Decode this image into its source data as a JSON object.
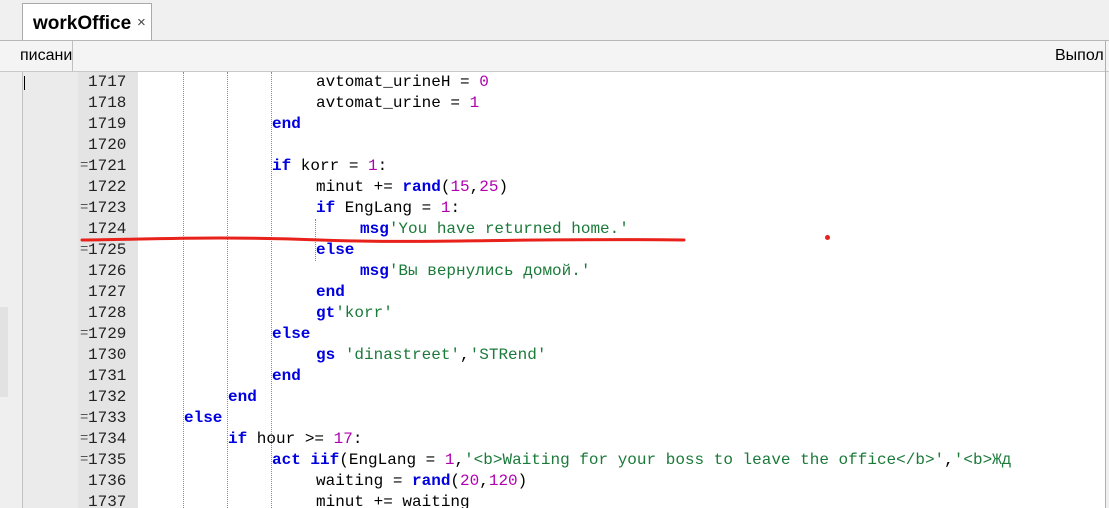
{
  "tab": {
    "title": "workOffice",
    "close_glyph": "×"
  },
  "subheader": {
    "left_label": "писани",
    "right_label": "Выпол"
  },
  "lines": [
    {
      "num": "1717",
      "fold": "",
      "parts": [
        {
          "t": "avtomat_urineH = ",
          "c": "op"
        },
        {
          "t": "0",
          "c": "num"
        }
      ]
    },
    {
      "num": "1718",
      "fold": "",
      "parts": [
        {
          "t": "avtomat_urine = ",
          "c": "op"
        },
        {
          "t": "1",
          "c": "num"
        }
      ]
    },
    {
      "num": "1719",
      "fold": "",
      "parts": [
        {
          "t": "end",
          "c": "kw"
        }
      ]
    },
    {
      "num": "1720",
      "fold": "",
      "parts": []
    },
    {
      "num": "1721",
      "fold": "=",
      "parts": [
        {
          "t": "if",
          "c": "kw"
        },
        {
          "t": " korr = ",
          "c": "op"
        },
        {
          "t": "1",
          "c": "num"
        },
        {
          "t": ":",
          "c": "op"
        }
      ]
    },
    {
      "num": "1722",
      "fold": "",
      "parts": [
        {
          "t": "minut += ",
          "c": "op"
        },
        {
          "t": "rand",
          "c": "kw"
        },
        {
          "t": "(",
          "c": "op"
        },
        {
          "t": "15",
          "c": "num"
        },
        {
          "t": ",",
          "c": "op"
        },
        {
          "t": "25",
          "c": "num"
        },
        {
          "t": ")",
          "c": "op"
        }
      ]
    },
    {
      "num": "1723",
      "fold": "=",
      "parts": [
        {
          "t": "if",
          "c": "kw"
        },
        {
          "t": " EngLang = ",
          "c": "op"
        },
        {
          "t": "1",
          "c": "num"
        },
        {
          "t": ":",
          "c": "op"
        }
      ]
    },
    {
      "num": "1724",
      "fold": "",
      "parts": [
        {
          "t": "msg",
          "c": "kw"
        },
        {
          "t": "'You have returned home.'",
          "c": "str"
        }
      ]
    },
    {
      "num": "1725",
      "fold": "=",
      "parts": [
        {
          "t": "else",
          "c": "kw"
        }
      ]
    },
    {
      "num": "1726",
      "fold": "",
      "parts": [
        {
          "t": "msg",
          "c": "kw"
        },
        {
          "t": "'Вы вернулись домой.'",
          "c": "str"
        }
      ]
    },
    {
      "num": "1727",
      "fold": "",
      "parts": [
        {
          "t": "end",
          "c": "kw"
        }
      ]
    },
    {
      "num": "1728",
      "fold": "",
      "parts": [
        {
          "t": "gt",
          "c": "kw"
        },
        {
          "t": "'korr'",
          "c": "str"
        }
      ]
    },
    {
      "num": "1729",
      "fold": "=",
      "parts": [
        {
          "t": "else",
          "c": "kw"
        }
      ]
    },
    {
      "num": "1730",
      "fold": "",
      "parts": [
        {
          "t": "gs",
          "c": "kw"
        },
        {
          "t": " ",
          "c": "op"
        },
        {
          "t": "'dinastreet'",
          "c": "str"
        },
        {
          "t": ",",
          "c": "op"
        },
        {
          "t": "'STRend'",
          "c": "str"
        }
      ]
    },
    {
      "num": "1731",
      "fold": "",
      "parts": [
        {
          "t": "end",
          "c": "kw"
        }
      ]
    },
    {
      "num": "1732",
      "fold": "",
      "parts": [
        {
          "t": "end",
          "c": "kw"
        }
      ]
    },
    {
      "num": "1733",
      "fold": "=",
      "parts": [
        {
          "t": "else",
          "c": "kw"
        }
      ]
    },
    {
      "num": "1734",
      "fold": "=",
      "parts": [
        {
          "t": "if",
          "c": "kw"
        },
        {
          "t": " hour >= ",
          "c": "op"
        },
        {
          "t": "17",
          "c": "num"
        },
        {
          "t": ":",
          "c": "op"
        }
      ]
    },
    {
      "num": "1735",
      "fold": "=",
      "parts": [
        {
          "t": "act",
          "c": "kw"
        },
        {
          "t": " ",
          "c": "op"
        },
        {
          "t": "iif",
          "c": "kw"
        },
        {
          "t": "(EngLang = ",
          "c": "op"
        },
        {
          "t": "1",
          "c": "num"
        },
        {
          "t": ",",
          "c": "op"
        },
        {
          "t": "'<b>Waiting for your boss to leave the office</b>'",
          "c": "str"
        },
        {
          "t": ",",
          "c": "op"
        },
        {
          "t": "'<b>Жд",
          "c": "str"
        }
      ]
    },
    {
      "num": "1736",
      "fold": "",
      "parts": [
        {
          "t": "waiting = ",
          "c": "op"
        },
        {
          "t": "rand",
          "c": "kw"
        },
        {
          "t": "(",
          "c": "op"
        },
        {
          "t": "20",
          "c": "num"
        },
        {
          "t": ",",
          "c": "op"
        },
        {
          "t": "120",
          "c": "num"
        },
        {
          "t": ")",
          "c": "op"
        }
      ]
    },
    {
      "num": "1737",
      "fold": "",
      "parts": [
        {
          "t": "minut += waiting",
          "c": "op"
        }
      ]
    }
  ],
  "colors": {
    "keyword": "#0000e0",
    "number": "#b000b0",
    "string": "#1b7a3a",
    "annotation": "#e8221a"
  }
}
